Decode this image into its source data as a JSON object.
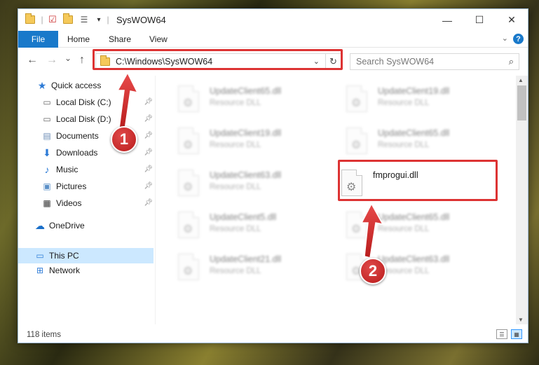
{
  "window": {
    "title": "SysWOW64",
    "minimize_label": "—",
    "maximize_label": "☐",
    "close_label": "✕"
  },
  "ribbon": {
    "tabs": [
      "File",
      "Home",
      "Share",
      "View"
    ],
    "help_label": "?"
  },
  "nav": {
    "back": "←",
    "forward": "→",
    "recent": "⌄",
    "up": "↑",
    "address": "C:\\Windows\\SysWOW64",
    "search_placeholder": "Search SysWOW64"
  },
  "sidebar": {
    "items": [
      {
        "label": "Quick access",
        "icon": "star-icon"
      },
      {
        "label": "Local Disk (C:)",
        "icon": "drive-icon"
      },
      {
        "label": "Local Disk (D:)",
        "icon": "drive-icon"
      },
      {
        "label": "Documents",
        "icon": "documents-icon"
      },
      {
        "label": "Downloads",
        "icon": "download-icon"
      },
      {
        "label": "Music",
        "icon": "music-icon"
      },
      {
        "label": "Pictures",
        "icon": "pictures-icon"
      },
      {
        "label": "Videos",
        "icon": "videos-icon"
      },
      {
        "label": "OneDrive",
        "icon": "cloud-icon"
      },
      {
        "label": "This PC",
        "icon": "computer-icon"
      },
      {
        "label": "Network",
        "icon": "network-icon"
      }
    ]
  },
  "files": [
    {
      "name": "UpdateClient65.dll",
      "type": "Resource DLL"
    },
    {
      "name": "UpdateClient19.dll",
      "type": "Resource DLL"
    },
    {
      "name": "UpdateClient19.dll",
      "type": "Resource DLL"
    },
    {
      "name": "UpdateClient65.dll",
      "type": "Resource DLL"
    },
    {
      "name": "UpdateClient63.dll",
      "type": "Resource DLL"
    },
    {
      "name": "fmprogui.dll",
      "type": ""
    },
    {
      "name": "UpdateClient5.dll",
      "type": "Resource DLL"
    },
    {
      "name": "UpdateClient65.dll",
      "type": "Resource DLL"
    },
    {
      "name": "UpdateClient21.dll",
      "type": "Resource DLL"
    },
    {
      "name": "UpdateClient63.dll",
      "type": "Resource DLL"
    }
  ],
  "status": {
    "item_count": "118 items"
  },
  "callouts": {
    "step1": "1",
    "step2": "2"
  },
  "colors": {
    "accent": "#1979ca",
    "highlight": "#d33333",
    "selected": "#cce8ff"
  }
}
